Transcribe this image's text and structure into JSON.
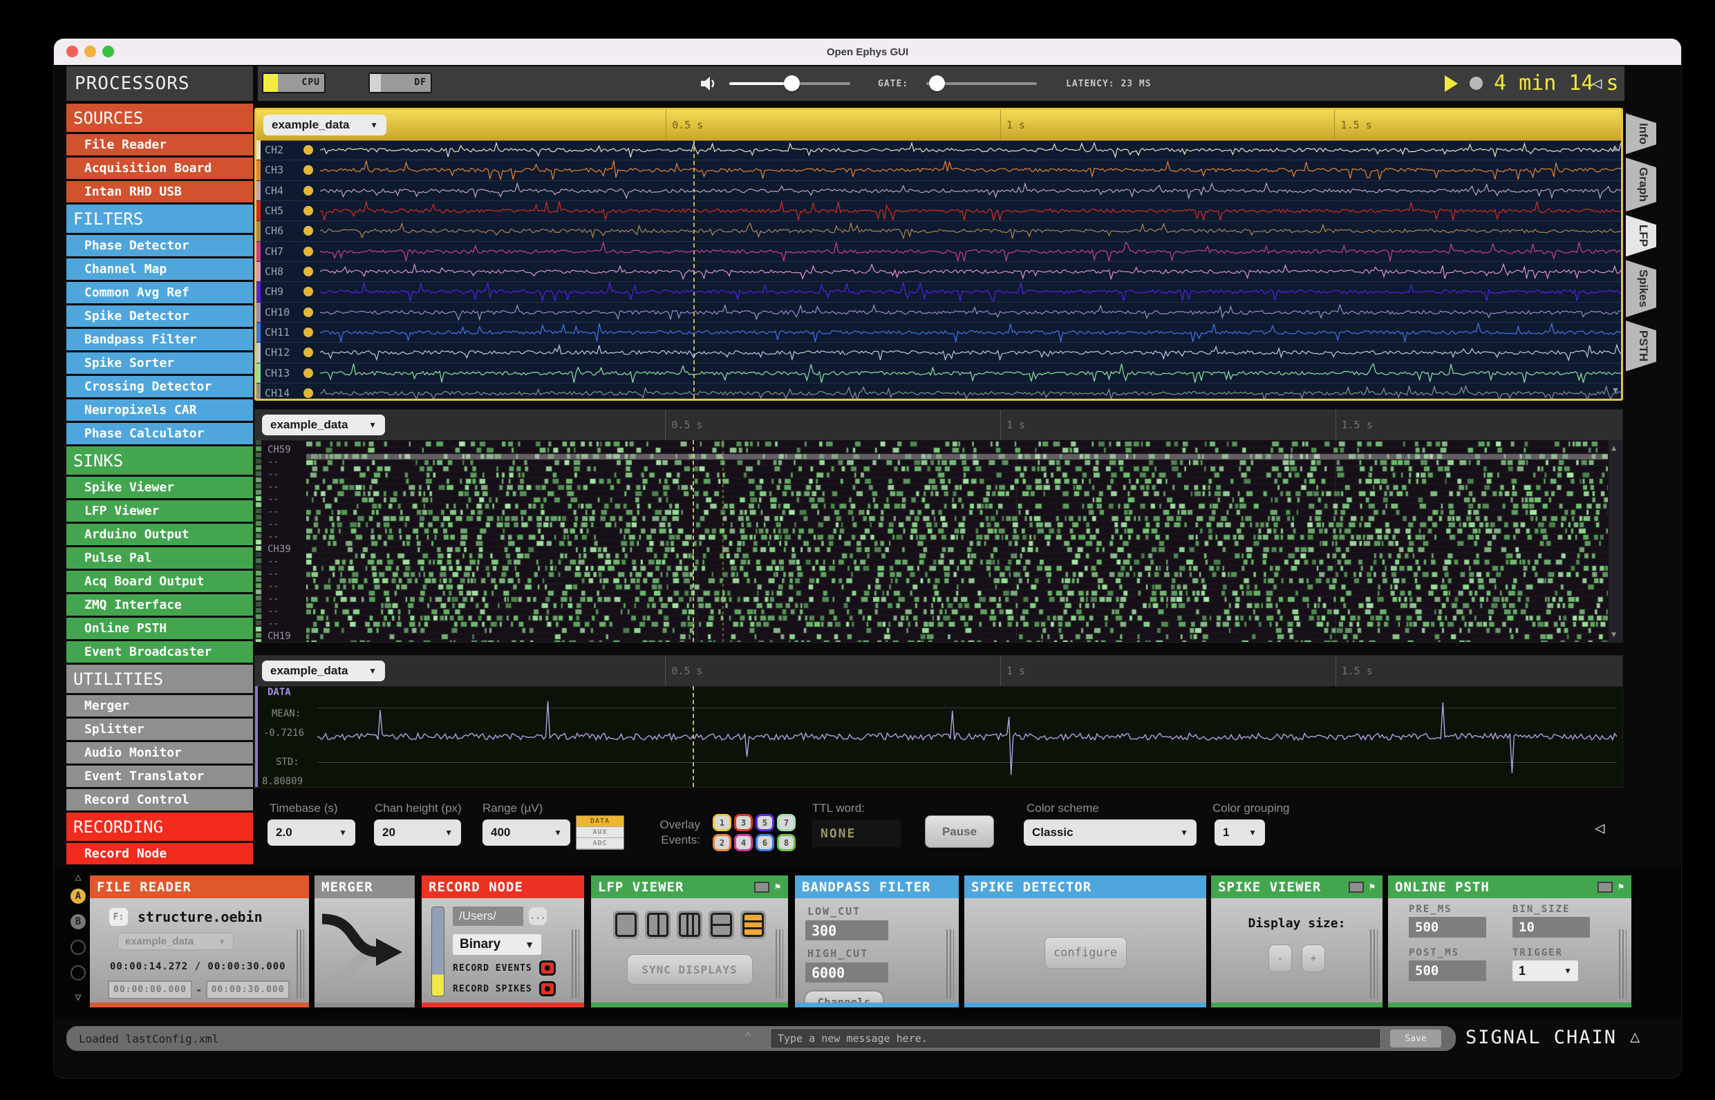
{
  "window": {
    "title": "Open Ephys GUI"
  },
  "toolbar": {
    "cpu_label": "CPU",
    "df_label": "DF",
    "gate_label": "GATE:",
    "latency": "LATENCY: 23 MS",
    "clock": "4 min 14 s"
  },
  "sidebar": {
    "title": "PROCESSORS",
    "sections": [
      {
        "label": "SOURCES",
        "color": "#D2522F",
        "items": [
          "File Reader",
          "Acquisition Board",
          "Intan RHD USB"
        ]
      },
      {
        "label": "FILTERS",
        "color": "#4FA6DD",
        "items": [
          "Phase Detector",
          "Channel Map",
          "Common Avg Ref",
          "Spike Detector",
          "Bandpass Filter",
          "Spike Sorter",
          "Crossing Detector",
          "Neuropixels CAR",
          "Phase Calculator"
        ]
      },
      {
        "label": "SINKS",
        "color": "#43A64F",
        "items": [
          "Spike Viewer",
          "LFP Viewer",
          "Arduino Output",
          "Pulse Pal",
          "Acq Board Output",
          "ZMQ Interface",
          "Online PSTH",
          "Event Broadcaster"
        ]
      },
      {
        "label": "UTILITIES",
        "color": "#8F8F8F",
        "items": [
          "Merger",
          "Splitter",
          "Audio Monitor",
          "Event Translator",
          "Record Control"
        ]
      },
      {
        "label": "RECORDING",
        "color": "#F22B1C",
        "items": [
          "Record Node"
        ]
      }
    ]
  },
  "tabs": {
    "items": [
      "Info",
      "Graph",
      "LFP",
      "Spikes",
      "PSTH"
    ],
    "active": "LFP"
  },
  "viewer": {
    "selector": "example_data",
    "time_labels": [
      {
        "label": "0.5 s",
        "pos": 0.3
      },
      {
        "label": "1 s",
        "pos": 0.545
      },
      {
        "label": "1.5 s",
        "pos": 0.79
      }
    ],
    "playhead_pos": 0.32,
    "lfp": {
      "channels": [
        {
          "name": "CH2",
          "color": "#E9E1C2"
        },
        {
          "name": "CH3",
          "color": "#E8822E"
        },
        {
          "name": "CH4",
          "color": "#C0A3B8"
        },
        {
          "name": "CH5",
          "color": "#D92B24"
        },
        {
          "name": "CH6",
          "color": "#B2854E"
        },
        {
          "name": "CH7",
          "color": "#CB3C9B"
        },
        {
          "name": "CH8",
          "color": "#DC93C7"
        },
        {
          "name": "CH9",
          "color": "#5620E8"
        },
        {
          "name": "CH10",
          "color": "#9C8CC8"
        },
        {
          "name": "CH11",
          "color": "#3E78E8"
        },
        {
          "name": "CH12",
          "color": "#BFC9E0"
        },
        {
          "name": "CH13",
          "color": "#8EE2A6"
        },
        {
          "name": "CH14",
          "color": "#8D8D98"
        }
      ]
    },
    "raster": {
      "dash": "--",
      "total_rows": 16,
      "row_labels": [
        {
          "label": "CH59",
          "row": 0
        },
        {
          "label": "CH39",
          "row": 8
        },
        {
          "label": "CH19",
          "row": 15
        }
      ]
    },
    "trace": {
      "title": "DATA",
      "mean_label": "MEAN:",
      "mean": "-0.7216",
      "std_label": "STD:",
      "std": "8.80809",
      "color": "#B29FE3"
    }
  },
  "controls": {
    "timebase": {
      "label": "Timebase (s)",
      "value": "2.0"
    },
    "chan_height": {
      "label": "Chan height (px)",
      "value": "20"
    },
    "range": {
      "label": "Range (µV)",
      "value": "400"
    },
    "signal_types": [
      {
        "label": "DATA",
        "active": true
      },
      {
        "label": "AUX",
        "active": false
      },
      {
        "label": "ADC",
        "active": false
      }
    ],
    "overlay_label_1": "Overlay",
    "overlay_label_2": "Events:",
    "event_buttons": [
      {
        "label": "1",
        "color": "#E7C93F"
      },
      {
        "label": "3",
        "color": "#D8392B"
      },
      {
        "label": "5",
        "color": "#5A2DE0"
      },
      {
        "label": "7",
        "color": "#9CE3AC"
      },
      {
        "label": "2",
        "color": "#E2823C"
      },
      {
        "label": "4",
        "color": "#C93F9B"
      },
      {
        "label": "6",
        "color": "#3E7BE4"
      },
      {
        "label": "8",
        "color": "#6CBE45"
      }
    ],
    "ttl": {
      "label": "TTL word:",
      "value": "NONE"
    },
    "pause_label": "Pause",
    "color_scheme": {
      "label": "Color scheme",
      "value": "Classic"
    },
    "color_grouping": {
      "label": "Color grouping",
      "value": "1"
    }
  },
  "chain": {
    "rail": {
      "a": "A",
      "b": "B"
    },
    "file_reader": {
      "title": "FILE READER",
      "color": "#E0572E",
      "file_button": "F:",
      "filename": "structure.oebin",
      "selector": "example_data",
      "time": "00:00:14.272 / 00:00:30.000",
      "start": "00:00:00.000",
      "end": "00:00:30.000"
    },
    "merger": {
      "title": "MERGER",
      "color": "#8E8E8E"
    },
    "record_node": {
      "title": "RECORD NODE",
      "color": "#EC3323",
      "path": "/Users/",
      "more": "...",
      "engine": "Binary",
      "events_label": "RECORD EVENTS",
      "spikes_label": "RECORD SPIKES"
    },
    "lfp_viewer": {
      "title": "LFP VIEWER",
      "color": "#43A64F",
      "sync_label": "SYNC DISPLAYS"
    },
    "bandpass": {
      "title": "BANDPASS FILTER",
      "color": "#4FA6DD",
      "low_label": "LOW_CUT",
      "low": "300",
      "high_label": "HIGH_CUT",
      "high": "6000",
      "channels_label": "Channels"
    },
    "spike_detector": {
      "title": "SPIKE DETECTOR",
      "color": "#4FA6DD",
      "configure_label": "configure"
    },
    "spike_viewer": {
      "title": "SPIKE VIEWER",
      "color": "#43A64F",
      "display_label": "Display size:",
      "minus": "-",
      "plus": "+"
    },
    "online_psth": {
      "title": "ONLINE PSTH",
      "color": "#43A64F",
      "pre_label": "PRE_MS",
      "pre": "500",
      "bin_label": "BIN_SIZE",
      "bin": "10",
      "post_label": "POST_MS",
      "post": "500",
      "trigger_label": "TRIGGER",
      "trigger": "1"
    }
  },
  "statusbar": {
    "message": "Loaded lastConfig.xml",
    "input_placeholder": "Type a new message here.",
    "save_label": "Save",
    "signal_chain_label": "SIGNAL CHAIN"
  }
}
